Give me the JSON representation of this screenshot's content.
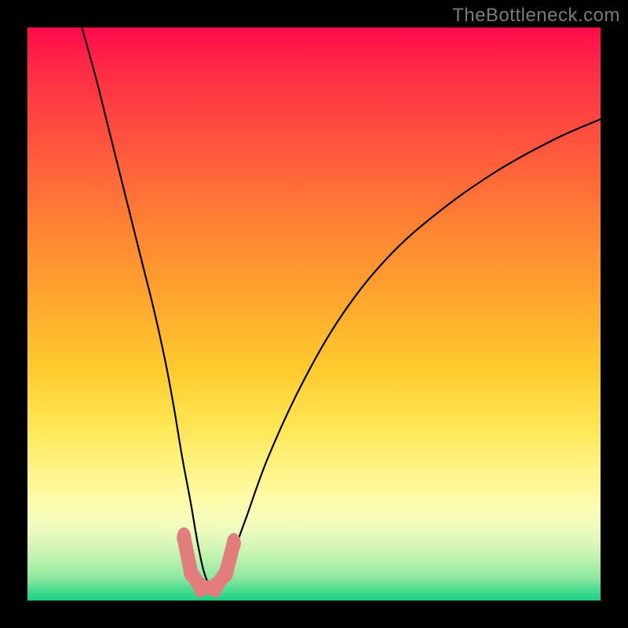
{
  "watermark": "TheBottleneck.com",
  "chart_data": {
    "type": "line",
    "title": "",
    "xlabel": "",
    "ylabel": "",
    "xlim": [
      0,
      100
    ],
    "ylim": [
      0,
      100
    ],
    "grid": false,
    "annotations": [],
    "series": [
      {
        "name": "curve",
        "x": [
          9.5,
          12,
          14,
          16,
          18,
          20,
          22,
          24,
          25.5,
          27,
          28.5,
          29.7,
          30.8,
          32,
          33,
          35,
          38,
          42,
          48,
          55,
          63,
          72,
          82,
          92,
          100
        ],
        "values": [
          100,
          91,
          83,
          75,
          67,
          59,
          51,
          42,
          34,
          25,
          17,
          10,
          5,
          2.3,
          2.3,
          6,
          14,
          25,
          38,
          50,
          60,
          68,
          75,
          80.5,
          84
        ]
      }
    ],
    "markers": [
      {
        "name": "left-upper",
        "x": 27.3,
        "y": 11.0
      },
      {
        "name": "left-lower",
        "x": 28.5,
        "y": 5.0
      },
      {
        "name": "valley-left",
        "x": 30.2,
        "y": 2.3
      },
      {
        "name": "valley-right",
        "x": 32.8,
        "y": 2.3
      },
      {
        "name": "right-lower",
        "x": 34.7,
        "y": 5.0
      },
      {
        "name": "right-upper",
        "x": 36.0,
        "y": 10.0
      }
    ],
    "gradient_stops": [
      {
        "pos": 0.0,
        "color": "#ff0a4a"
      },
      {
        "pos": 0.35,
        "color": "#ff8433"
      },
      {
        "pos": 0.7,
        "color": "#ffe757"
      },
      {
        "pos": 0.87,
        "color": "#f2fbbe"
      },
      {
        "pos": 1.0,
        "color": "#17d084"
      }
    ]
  }
}
